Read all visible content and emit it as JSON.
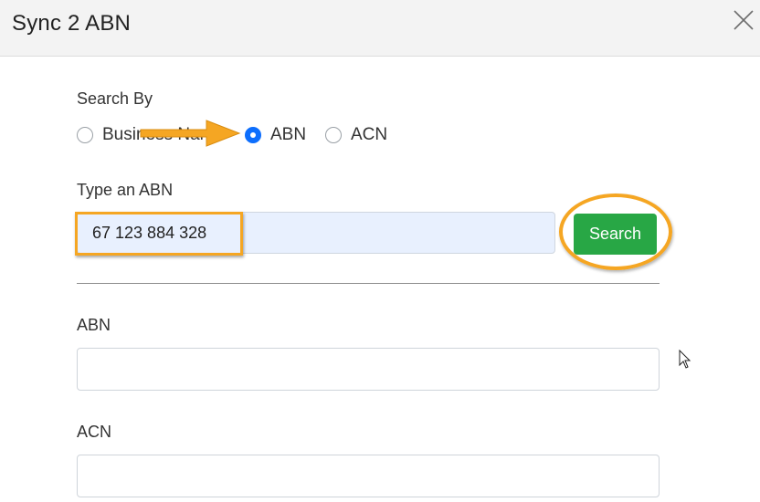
{
  "dialog": {
    "title": "Sync 2 ABN",
    "close_icon": "close-icon"
  },
  "search_by": {
    "label": "Search By",
    "options": [
      {
        "label": "Business Name",
        "checked": false
      },
      {
        "label": "ABN",
        "checked": true
      },
      {
        "label": "ACN",
        "checked": false
      }
    ]
  },
  "search": {
    "label": "Type an ABN",
    "value": "67 123 884 328",
    "button_label": "Search"
  },
  "fields": {
    "abn_label": "ABN",
    "abn_value": "",
    "acn_label": "ACN",
    "acn_value": ""
  },
  "annotations": {
    "highlight_color": "#f5a623",
    "accent_radio": "#0d6efd",
    "button_color": "#28a745"
  }
}
